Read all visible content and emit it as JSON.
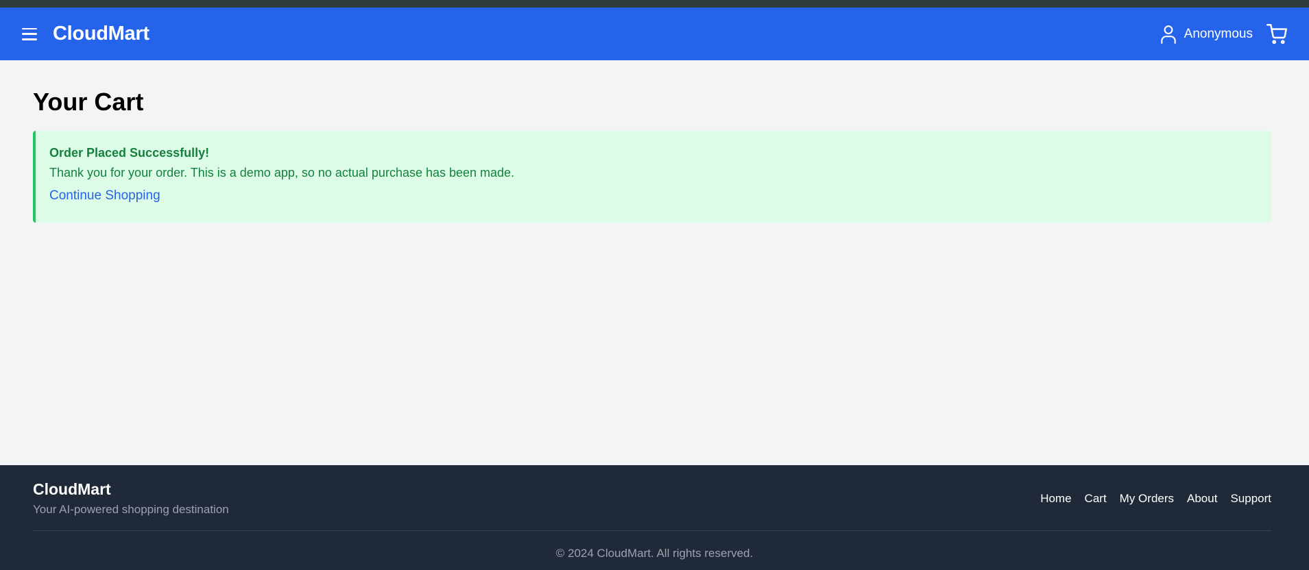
{
  "header": {
    "brand": "CloudMart",
    "user_name": "Anonymous"
  },
  "main": {
    "title": "Your Cart",
    "alert": {
      "title": "Order Placed Successfully!",
      "message": "Thank you for your order. This is a demo app, so no actual purchase has been made.",
      "link": "Continue Shopping"
    }
  },
  "footer": {
    "brand": "CloudMart",
    "tagline": "Your AI-powered shopping destination",
    "nav": [
      "Home",
      "Cart",
      "My Orders",
      "About",
      "Support"
    ],
    "copyright": "© 2024 CloudMart. All rights reserved."
  },
  "colors": {
    "brand_blue": "#2563eb",
    "success_bg": "#dcfce7",
    "success_border": "#22c55e",
    "success_text": "#15803d",
    "footer_bg": "#1f2937"
  },
  "icons": [
    "menu-icon",
    "user-icon",
    "cart-icon"
  ]
}
